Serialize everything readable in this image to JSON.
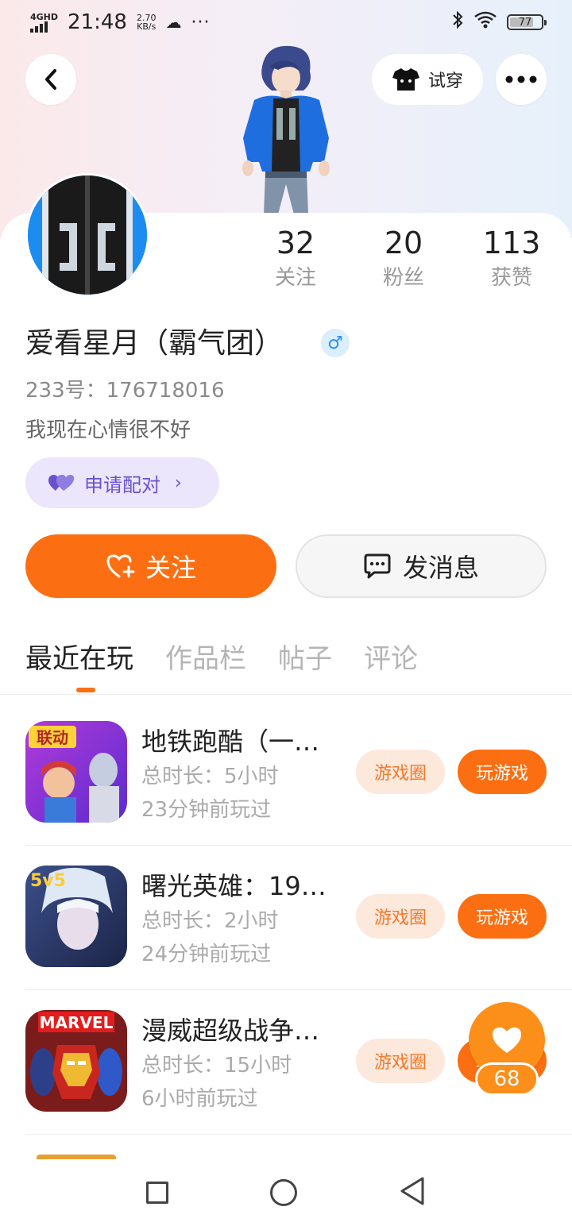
{
  "status_bar": {
    "network": "4GHD",
    "time": "21:48",
    "speed_value": "2.70",
    "speed_unit": "KB/s",
    "more": "···",
    "battery": "77"
  },
  "header": {
    "try_on_label": "试穿"
  },
  "profile": {
    "stats": [
      {
        "value": "32",
        "label": "关注"
      },
      {
        "value": "20",
        "label": "粉丝"
      },
      {
        "value": "113",
        "label": "获赞"
      }
    ],
    "name": "爱看星月（霸气团）",
    "gender_symbol": "♂",
    "uid": "233号：176718016",
    "signature": "我现在心情很不好",
    "pair_label": "申请配对"
  },
  "actions": {
    "follow_label": "关注",
    "message_label": "发消息"
  },
  "tabs": [
    "最近在玩",
    "作品栏",
    "帖子",
    "评论"
  ],
  "games": [
    {
      "title": "地铁跑酷（一…",
      "duration": "总时长：5小时",
      "last_played": "23分钟前玩过",
      "circle_label": "游戏圈",
      "play_label": "玩游戏",
      "icon_text": "联动"
    },
    {
      "title": "曙光英雄：19…",
      "duration": "总时长：2小时",
      "last_played": "24分钟前玩过",
      "circle_label": "游戏圈",
      "play_label": "玩游戏",
      "icon_text": "5v5"
    },
    {
      "title": "漫威超级战争…",
      "duration": "总时长：15小时",
      "last_played": "6小时前玩过",
      "circle_label": "游戏圈",
      "play_label": "玩游戏",
      "icon_text": "MARVEL"
    }
  ],
  "like_float": {
    "count": "68"
  },
  "colors": {
    "accent": "#fb6f12",
    "pair_bg": "#ebe6fb",
    "pair_text": "#6a52cf"
  }
}
